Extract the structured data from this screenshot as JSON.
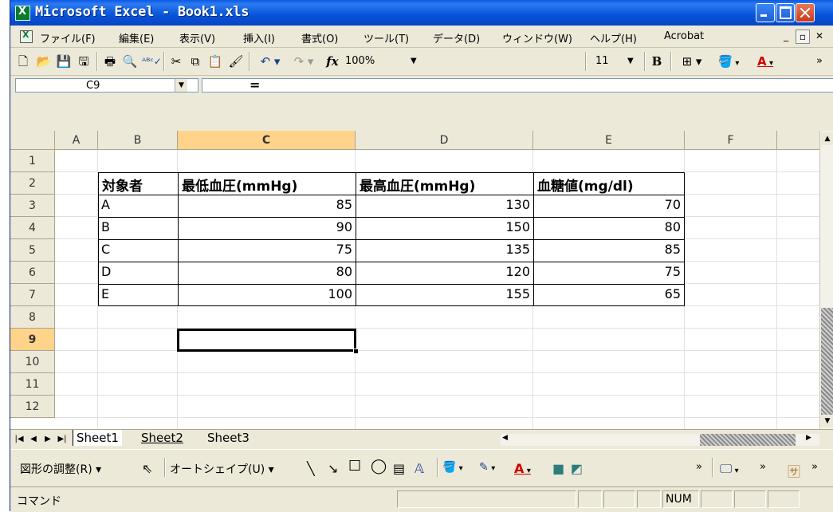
{
  "window": {
    "title": "Microsoft Excel - Book1.xls"
  },
  "menubar": {
    "items": [
      "ファイル(F)",
      "編集(E)",
      "表示(V)",
      "挿入(I)",
      "書式(O)",
      "ツール(T)",
      "データ(D)",
      "ウィンドウ(W)",
      "ヘルプ(H)",
      "Acrobat"
    ]
  },
  "toolbar": {
    "zoom": "100%",
    "font_size": "11",
    "bold_label": "B"
  },
  "formula_bar": {
    "cell_ref": "C9",
    "equals": "="
  },
  "grid": {
    "columns": [
      "A",
      "B",
      "C",
      "D",
      "E",
      "F"
    ],
    "rows": [
      "1",
      "2",
      "3",
      "4",
      "5",
      "6",
      "7",
      "8",
      "9",
      "10",
      "11",
      "12"
    ],
    "selected_cell": "C9",
    "table": {
      "headers": [
        "対象者",
        "最低血圧(mmHg)",
        "最高血圧(mmHg)",
        "血糖値(mg/dl)"
      ],
      "rows": [
        [
          "A",
          "85",
          "130",
          "70"
        ],
        [
          "B",
          "90",
          "150",
          "80"
        ],
        [
          "C",
          "75",
          "135",
          "85"
        ],
        [
          "D",
          "80",
          "120",
          "75"
        ],
        [
          "E",
          "100",
          "155",
          "65"
        ]
      ]
    }
  },
  "sheets": [
    "Sheet1",
    "Sheet2",
    "Sheet3"
  ],
  "drawing_toolbar": {
    "draw_menu": "図形の調整(R)",
    "autoshape_menu": "オートシェイプ(U)"
  },
  "statusbar": {
    "mode": "コマンド",
    "num": "NUM"
  }
}
